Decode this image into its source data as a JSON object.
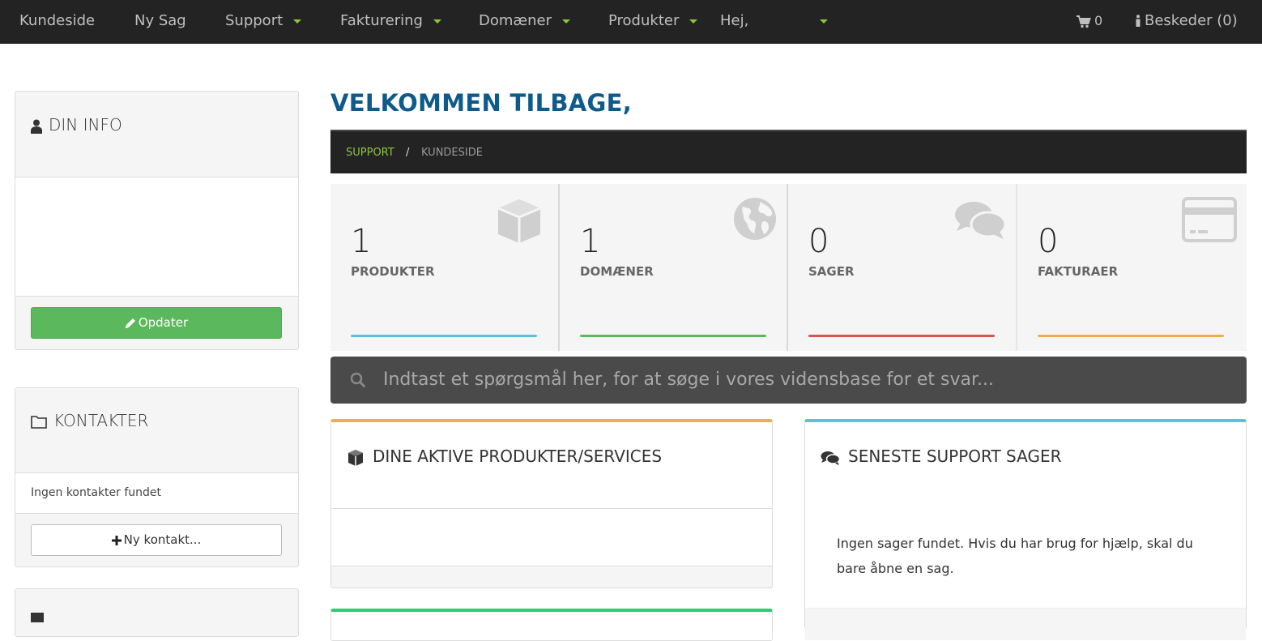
{
  "nav": {
    "home": "Kundeside",
    "new_ticket": "Ny Sag",
    "support": "Support",
    "billing": "Fakturering",
    "domains": "Domæner",
    "products": "Produkter",
    "greeting": "Hej,",
    "cart_count": "0",
    "messages": "Beskeder (0)"
  },
  "sidebar": {
    "info_title": "DIN INFO",
    "update_button": "Opdater",
    "contacts_title": "KONTAKTER",
    "no_contacts": "Ingen kontakter fundet",
    "new_contact_button": "Ny kontakt..."
  },
  "main": {
    "welcome": "VELKOMMEN TILBAGE,",
    "breadcrumb": [
      "SUPPORT",
      "KUNDESIDE"
    ],
    "breadcrumb_sep": "/",
    "tiles": [
      {
        "value": "1",
        "label": "PRODUKTER",
        "color": "#5bc0de"
      },
      {
        "value": "1",
        "label": "DOMÆNER",
        "color": "#5cb85c"
      },
      {
        "value": "0",
        "label": "SAGER",
        "color": "#d9534f"
      },
      {
        "value": "0",
        "label": "FAKTURAER",
        "color": "#f0ad4e"
      }
    ],
    "search_placeholder": "Indtast et spørgsmål her, for at søge i vores vidensbase for et svar...",
    "products_card_title": "DINE AKTIVE PRODUKTER/SERVICES",
    "tickets_card_title": "SENESTE SUPPORT SAGER",
    "no_tickets_text": "Ingen sager fundet. Hvis du har brug for hjælp, skal du bare åbne en sag."
  },
  "colors": {
    "accent_green": "#8cc63f",
    "title_blue": "#0e5a8a",
    "products_card_top": "#f0ad4e",
    "tickets_card_top": "#5bc0de",
    "third_card_top": "#2ecc71"
  }
}
